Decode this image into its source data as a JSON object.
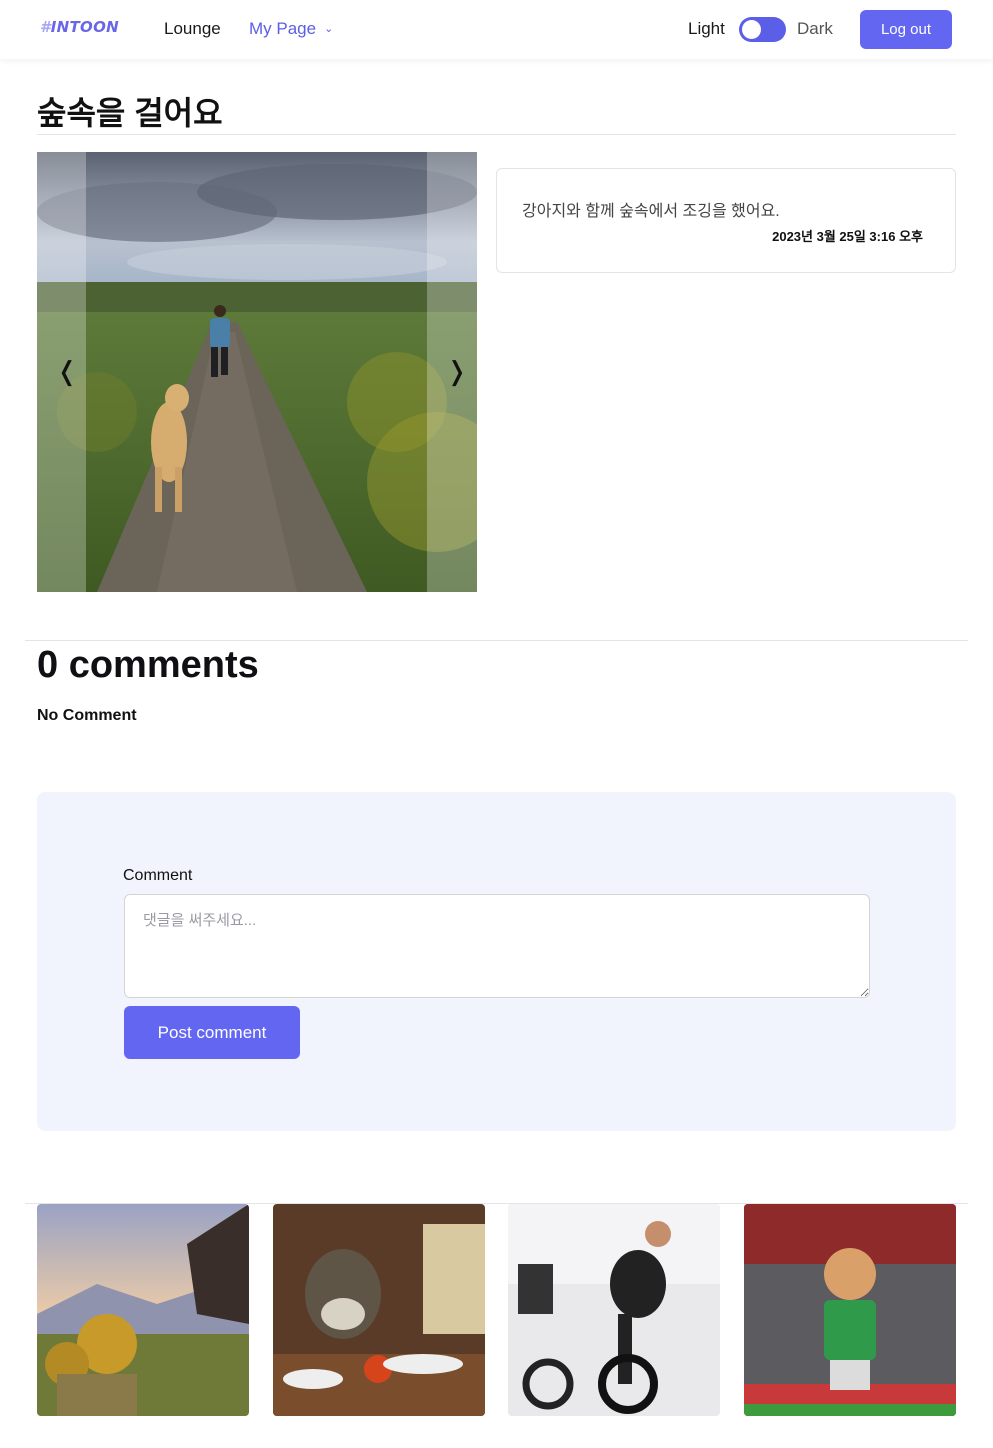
{
  "header": {
    "logo_hash": "#",
    "logo_text": "INTOON",
    "nav_lounge": "Lounge",
    "nav_mypage": "My Page",
    "theme_light": "Light",
    "theme_dark": "Dark",
    "logout": "Log out"
  },
  "post": {
    "title": "숲속을 걸어요",
    "description": "강아지와 함께 숲속에서 조깅을 했어요.",
    "date": "2023년 3월 25일 3:16 오후",
    "prev_arrow": "❬",
    "next_arrow": "❭"
  },
  "comments": {
    "count_label": "0 comments",
    "empty_label": "No Comment",
    "form_label": "Comment",
    "placeholder": "댓글을 써주세요...",
    "submit": "Post comment"
  },
  "colors": {
    "accent": "#6366f1",
    "panel": "#f1f4fd"
  },
  "icons": [
    "chevron-down-icon",
    "prev-arrow-icon",
    "next-arrow-icon"
  ]
}
